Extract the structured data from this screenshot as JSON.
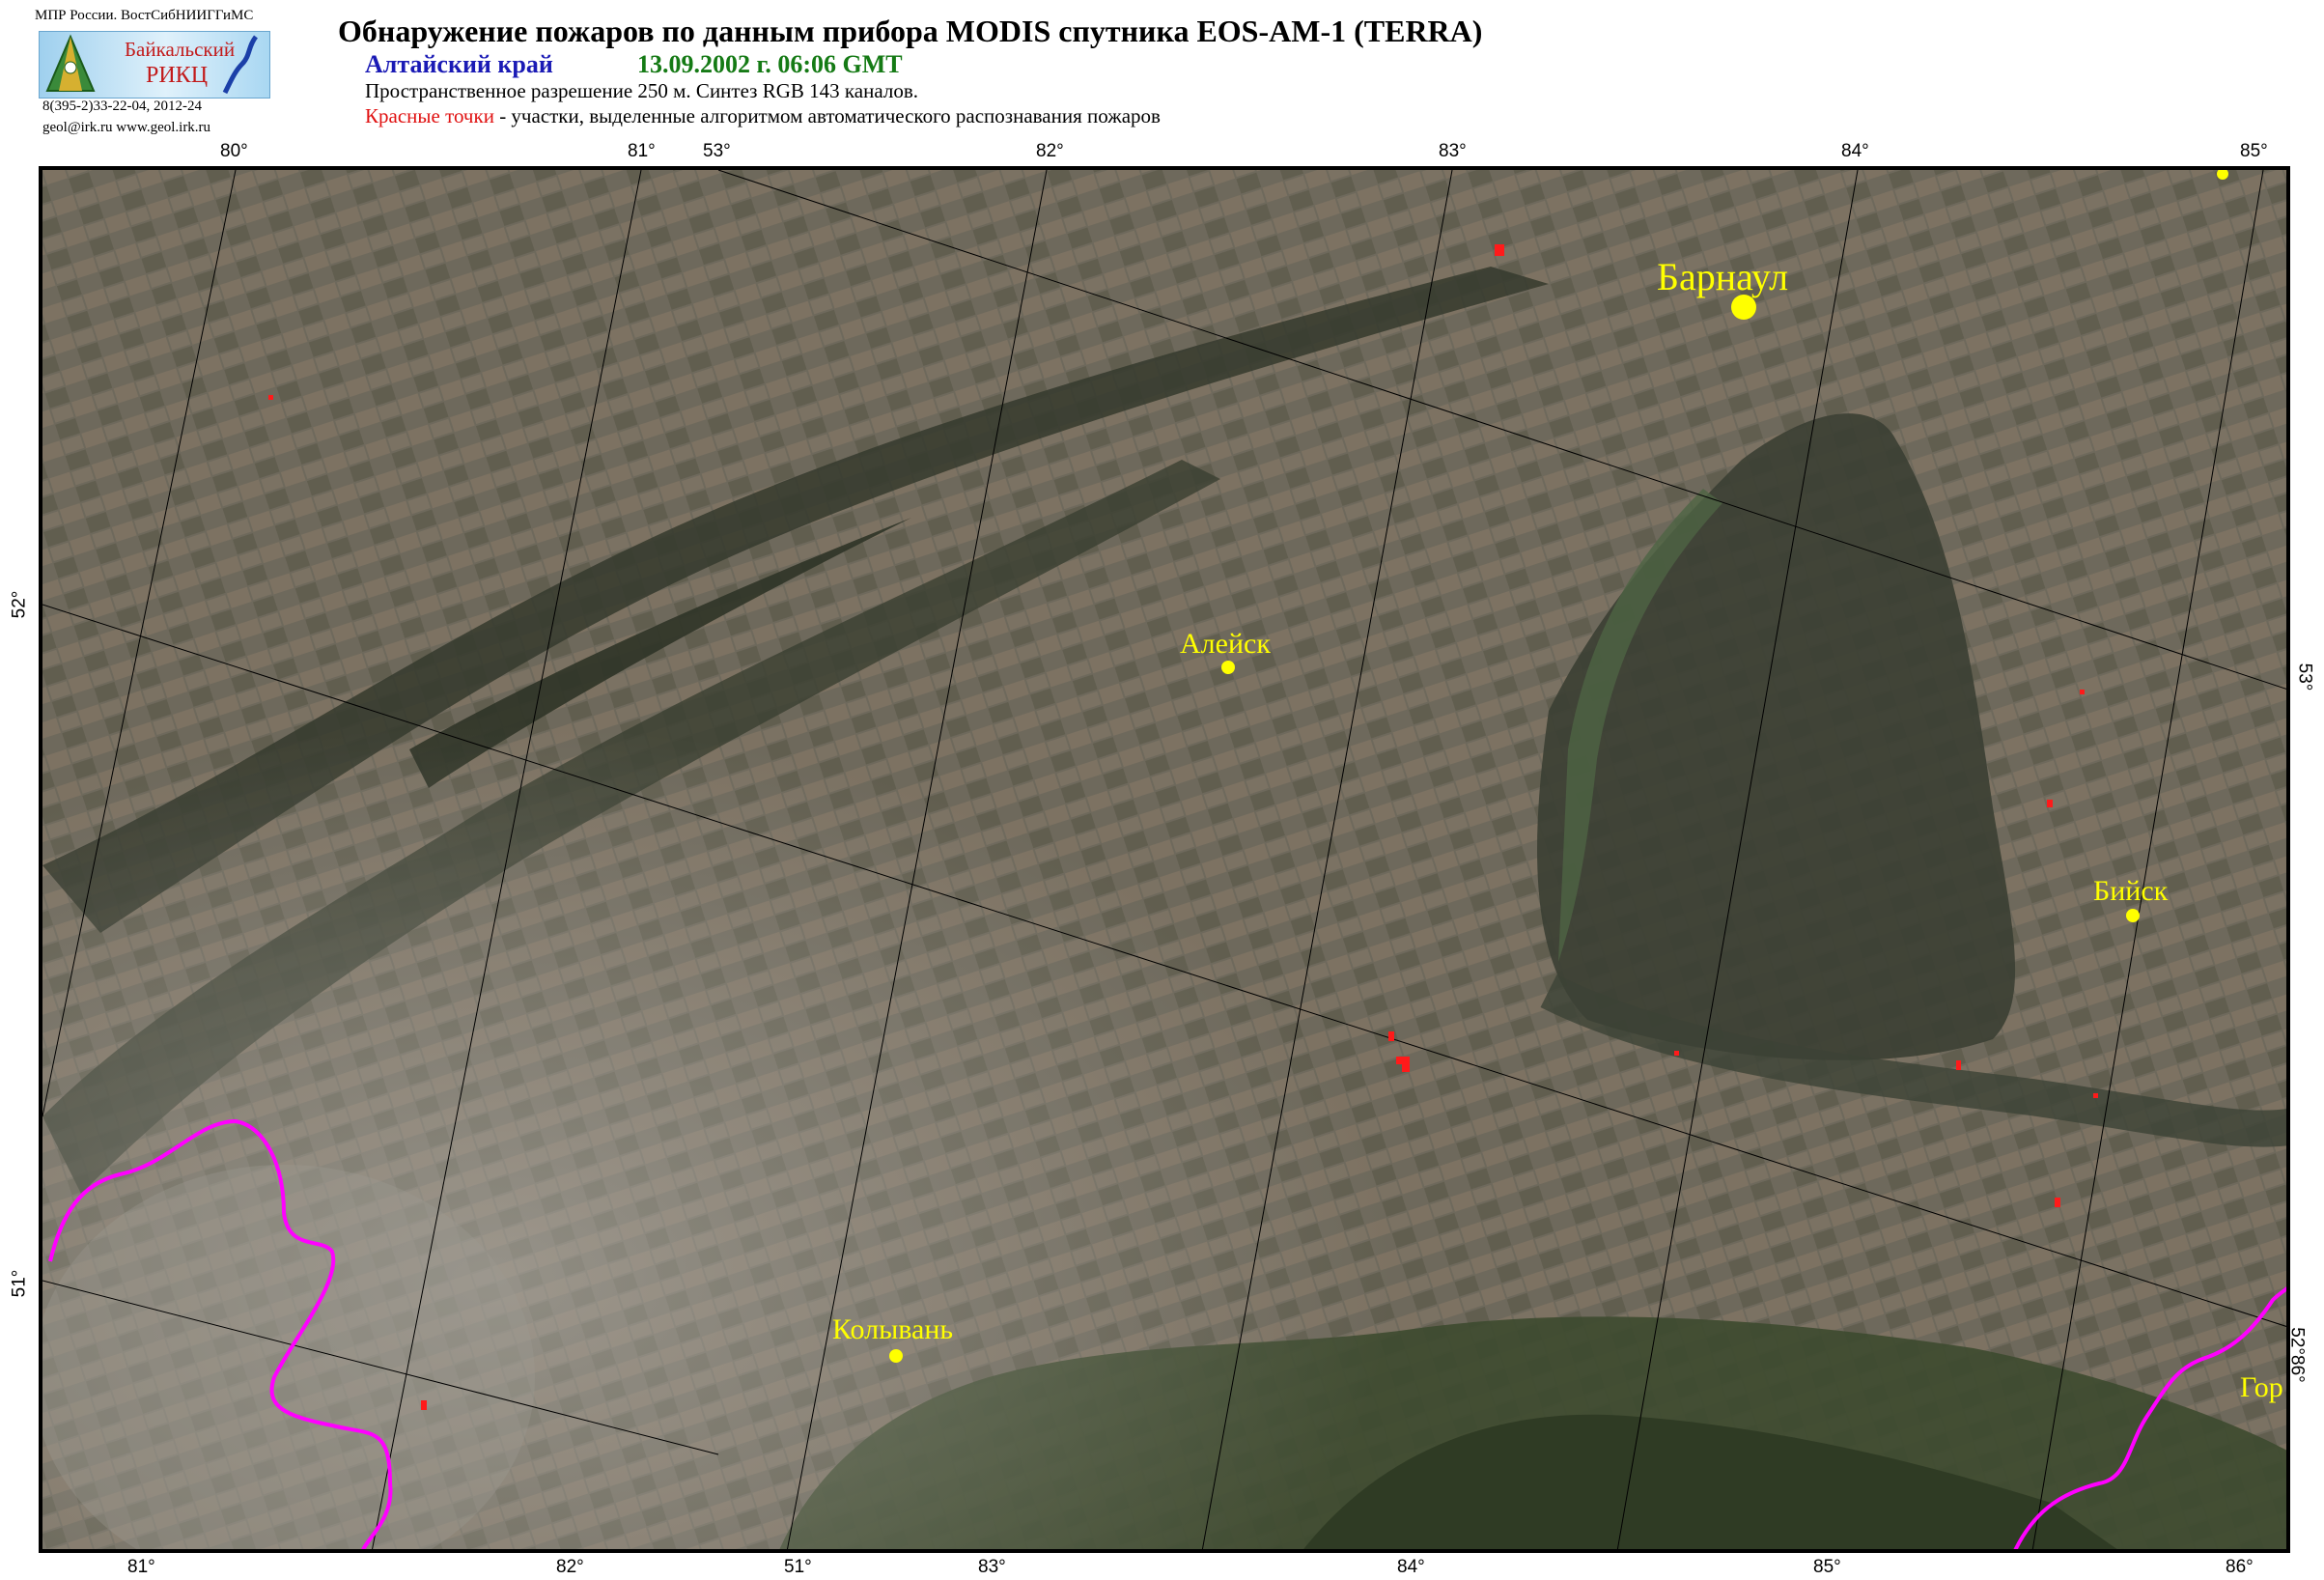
{
  "header": {
    "org": "МПР России. ВостСибНИИГГиМС",
    "logo_line1": "Байкальский",
    "logo_line2": "РИКЦ",
    "phone": "8(395-2)33-22-04, 2012-24",
    "email": "geol@irk.ru  www.geol.irk.ru",
    "title": "Обнаружение пожаров по данным прибора MODIS спутника EOS-AM-1 (TERRA)",
    "region": "Алтайский край",
    "datetime": "13.09.2002 г. 06:06 GMT",
    "resolution": "Пространственное разрешение 250 м. Синтез RGB 143 каналов.",
    "legend_red": "Красные точки",
    "legend_rest": " - участки, выделенные алгоритмом автоматического распознавания пожаров"
  },
  "colors": {
    "city": "#ffff00",
    "fire": "#ff1a1a",
    "border": "#ff00ff",
    "title_region": "#1a1ab5",
    "title_date": "#157a15"
  },
  "ticks": {
    "top": [
      "80°",
      "81°",
      "53°",
      "82°",
      "83°",
      "84°",
      "85°"
    ],
    "bottom": [
      "81°",
      "82°",
      "51°",
      "83°",
      "84°",
      "85°",
      "86°"
    ],
    "left": [
      "52°",
      "51°"
    ],
    "right": [
      "53°",
      "52°86°"
    ]
  },
  "cities": [
    {
      "name": "Барнаул",
      "big": true
    },
    {
      "name": "Алейск",
      "big": false
    },
    {
      "name": "Бийск",
      "big": false
    },
    {
      "name": "Колывань",
      "big": false
    },
    {
      "name": "Гор",
      "big": false
    }
  ]
}
